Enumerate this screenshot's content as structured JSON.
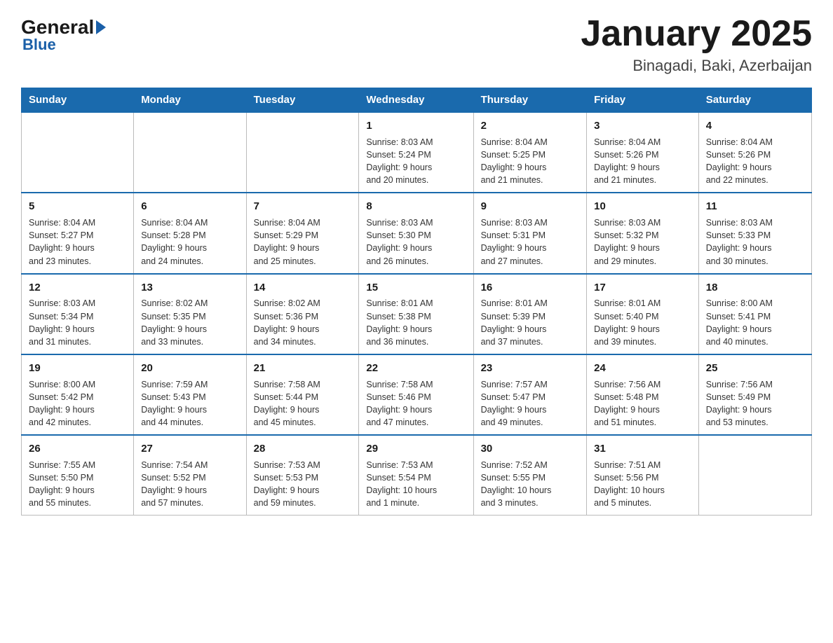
{
  "header": {
    "logo_general": "General",
    "logo_blue": "Blue",
    "month_title": "January 2025",
    "location": "Binagadi, Baki, Azerbaijan"
  },
  "days_of_week": [
    "Sunday",
    "Monday",
    "Tuesday",
    "Wednesday",
    "Thursday",
    "Friday",
    "Saturday"
  ],
  "weeks": [
    [
      {
        "num": "",
        "info": ""
      },
      {
        "num": "",
        "info": ""
      },
      {
        "num": "",
        "info": ""
      },
      {
        "num": "1",
        "info": "Sunrise: 8:03 AM\nSunset: 5:24 PM\nDaylight: 9 hours\nand 20 minutes."
      },
      {
        "num": "2",
        "info": "Sunrise: 8:04 AM\nSunset: 5:25 PM\nDaylight: 9 hours\nand 21 minutes."
      },
      {
        "num": "3",
        "info": "Sunrise: 8:04 AM\nSunset: 5:26 PM\nDaylight: 9 hours\nand 21 minutes."
      },
      {
        "num": "4",
        "info": "Sunrise: 8:04 AM\nSunset: 5:26 PM\nDaylight: 9 hours\nand 22 minutes."
      }
    ],
    [
      {
        "num": "5",
        "info": "Sunrise: 8:04 AM\nSunset: 5:27 PM\nDaylight: 9 hours\nand 23 minutes."
      },
      {
        "num": "6",
        "info": "Sunrise: 8:04 AM\nSunset: 5:28 PM\nDaylight: 9 hours\nand 24 minutes."
      },
      {
        "num": "7",
        "info": "Sunrise: 8:04 AM\nSunset: 5:29 PM\nDaylight: 9 hours\nand 25 minutes."
      },
      {
        "num": "8",
        "info": "Sunrise: 8:03 AM\nSunset: 5:30 PM\nDaylight: 9 hours\nand 26 minutes."
      },
      {
        "num": "9",
        "info": "Sunrise: 8:03 AM\nSunset: 5:31 PM\nDaylight: 9 hours\nand 27 minutes."
      },
      {
        "num": "10",
        "info": "Sunrise: 8:03 AM\nSunset: 5:32 PM\nDaylight: 9 hours\nand 29 minutes."
      },
      {
        "num": "11",
        "info": "Sunrise: 8:03 AM\nSunset: 5:33 PM\nDaylight: 9 hours\nand 30 minutes."
      }
    ],
    [
      {
        "num": "12",
        "info": "Sunrise: 8:03 AM\nSunset: 5:34 PM\nDaylight: 9 hours\nand 31 minutes."
      },
      {
        "num": "13",
        "info": "Sunrise: 8:02 AM\nSunset: 5:35 PM\nDaylight: 9 hours\nand 33 minutes."
      },
      {
        "num": "14",
        "info": "Sunrise: 8:02 AM\nSunset: 5:36 PM\nDaylight: 9 hours\nand 34 minutes."
      },
      {
        "num": "15",
        "info": "Sunrise: 8:01 AM\nSunset: 5:38 PM\nDaylight: 9 hours\nand 36 minutes."
      },
      {
        "num": "16",
        "info": "Sunrise: 8:01 AM\nSunset: 5:39 PM\nDaylight: 9 hours\nand 37 minutes."
      },
      {
        "num": "17",
        "info": "Sunrise: 8:01 AM\nSunset: 5:40 PM\nDaylight: 9 hours\nand 39 minutes."
      },
      {
        "num": "18",
        "info": "Sunrise: 8:00 AM\nSunset: 5:41 PM\nDaylight: 9 hours\nand 40 minutes."
      }
    ],
    [
      {
        "num": "19",
        "info": "Sunrise: 8:00 AM\nSunset: 5:42 PM\nDaylight: 9 hours\nand 42 minutes."
      },
      {
        "num": "20",
        "info": "Sunrise: 7:59 AM\nSunset: 5:43 PM\nDaylight: 9 hours\nand 44 minutes."
      },
      {
        "num": "21",
        "info": "Sunrise: 7:58 AM\nSunset: 5:44 PM\nDaylight: 9 hours\nand 45 minutes."
      },
      {
        "num": "22",
        "info": "Sunrise: 7:58 AM\nSunset: 5:46 PM\nDaylight: 9 hours\nand 47 minutes."
      },
      {
        "num": "23",
        "info": "Sunrise: 7:57 AM\nSunset: 5:47 PM\nDaylight: 9 hours\nand 49 minutes."
      },
      {
        "num": "24",
        "info": "Sunrise: 7:56 AM\nSunset: 5:48 PM\nDaylight: 9 hours\nand 51 minutes."
      },
      {
        "num": "25",
        "info": "Sunrise: 7:56 AM\nSunset: 5:49 PM\nDaylight: 9 hours\nand 53 minutes."
      }
    ],
    [
      {
        "num": "26",
        "info": "Sunrise: 7:55 AM\nSunset: 5:50 PM\nDaylight: 9 hours\nand 55 minutes."
      },
      {
        "num": "27",
        "info": "Sunrise: 7:54 AM\nSunset: 5:52 PM\nDaylight: 9 hours\nand 57 minutes."
      },
      {
        "num": "28",
        "info": "Sunrise: 7:53 AM\nSunset: 5:53 PM\nDaylight: 9 hours\nand 59 minutes."
      },
      {
        "num": "29",
        "info": "Sunrise: 7:53 AM\nSunset: 5:54 PM\nDaylight: 10 hours\nand 1 minute."
      },
      {
        "num": "30",
        "info": "Sunrise: 7:52 AM\nSunset: 5:55 PM\nDaylight: 10 hours\nand 3 minutes."
      },
      {
        "num": "31",
        "info": "Sunrise: 7:51 AM\nSunset: 5:56 PM\nDaylight: 10 hours\nand 5 minutes."
      },
      {
        "num": "",
        "info": ""
      }
    ]
  ]
}
